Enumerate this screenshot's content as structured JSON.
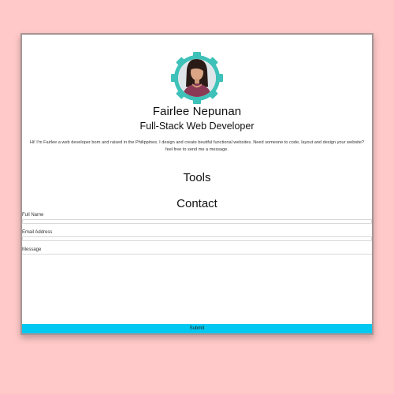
{
  "profile": {
    "name": "Fairlee Nepunan",
    "role": "Full-Stack Web Developer",
    "bio": "Hi! I'm Fairlee a web developer born and raised in the Philippines. I design and create beutiful functional websites. Need someone to code, layout and design your website? feel free to send me a message.",
    "avatar_ring_color": "#3ec1b8"
  },
  "sections": {
    "tools_title": "Tools",
    "contact_title": "Contact"
  },
  "contact_form": {
    "full_name_label": "Full Name",
    "full_name_value": "",
    "email_label": "Email Address",
    "email_value": "",
    "message_label": "Message",
    "message_value": "",
    "submit_label": "Submit",
    "submit_color": "#00c8f0"
  },
  "colors": {
    "page_background": "#ffc9c9",
    "card_background": "#ffffff",
    "card_border": "#a69595"
  }
}
